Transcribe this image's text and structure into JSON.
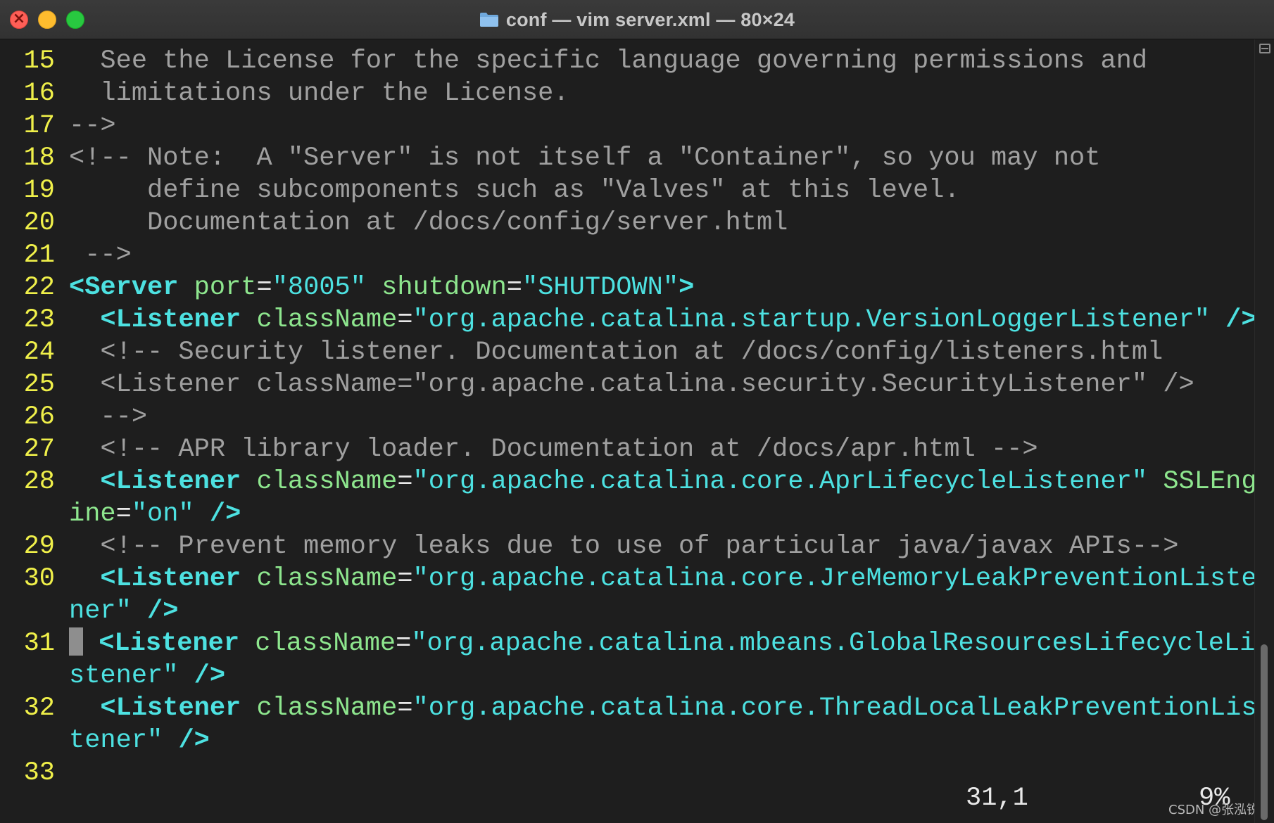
{
  "window": {
    "title": "conf — vim server.xml — 80×24",
    "folder_icon": "folder-icon"
  },
  "lines": [
    {
      "n": "15",
      "y": 0,
      "segs": [
        [
          "c",
          "  See the License for the specific language governing permissions and"
        ]
      ]
    },
    {
      "n": "16",
      "y": 1,
      "segs": [
        [
          "c",
          "  limitations under the License."
        ]
      ]
    },
    {
      "n": "17",
      "y": 2,
      "segs": [
        [
          "c",
          "-->"
        ]
      ]
    },
    {
      "n": "18",
      "y": 3,
      "segs": [
        [
          "c",
          "<!-- Note:  A \"Server\" is not itself a \"Container\", so you may not"
        ]
      ]
    },
    {
      "n": "19",
      "y": 4,
      "segs": [
        [
          "c",
          "     define subcomponents such as \"Valves\" at this level."
        ]
      ]
    },
    {
      "n": "20",
      "y": 5,
      "segs": [
        [
          "c",
          "     Documentation at /docs/config/server.html"
        ]
      ]
    },
    {
      "n": "21",
      "y": 6,
      "segs": [
        [
          "c",
          " -->"
        ]
      ]
    },
    {
      "n": "22",
      "y": 7,
      "segs": [
        [
          "tag",
          "<Server"
        ],
        [
          "plain",
          " "
        ],
        [
          "attr",
          "port"
        ],
        [
          "plain",
          "="
        ],
        [
          "val",
          "\"8005\""
        ],
        [
          "plain",
          " "
        ],
        [
          "attr",
          "shutdown"
        ],
        [
          "plain",
          "="
        ],
        [
          "val",
          "\"SHUTDOWN\""
        ],
        [
          "tag",
          ">"
        ]
      ]
    },
    {
      "n": "23",
      "y": 8,
      "segs": [
        [
          "plain",
          "  "
        ],
        [
          "tag",
          "<Listener"
        ],
        [
          "plain",
          " "
        ],
        [
          "attr",
          "className"
        ],
        [
          "plain",
          "="
        ],
        [
          "val",
          "\"org.apache.catalina.startup.VersionLoggerListener\""
        ],
        [
          "plain",
          " "
        ],
        [
          "tag",
          "/>"
        ]
      ]
    },
    {
      "n": "24",
      "y": 9,
      "segs": [
        [
          "c",
          "  <!-- Security listener. Documentation at /docs/config/listeners.html"
        ]
      ]
    },
    {
      "n": "25",
      "y": 10,
      "segs": [
        [
          "c",
          "  <Listener className=\"org.apache.catalina.security.SecurityListener\" />"
        ]
      ]
    },
    {
      "n": "26",
      "y": 11,
      "segs": [
        [
          "c",
          "  -->"
        ]
      ]
    },
    {
      "n": "27",
      "y": 12,
      "segs": [
        [
          "c",
          "  <!-- APR library loader. Documentation at /docs/apr.html -->"
        ]
      ]
    },
    {
      "n": "28",
      "y": 13,
      "segs": [
        [
          "plain",
          "  "
        ],
        [
          "tag",
          "<Listener"
        ],
        [
          "plain",
          " "
        ],
        [
          "attr",
          "className"
        ],
        [
          "plain",
          "="
        ],
        [
          "val",
          "\"org.apache.catalina.core.AprLifecycleListener\""
        ],
        [
          "plain",
          " "
        ],
        [
          "attr",
          "SSLEng"
        ]
      ]
    },
    {
      "n": "",
      "y": 14,
      "segs": [
        [
          "attr",
          "ine"
        ],
        [
          "plain",
          "="
        ],
        [
          "val",
          "\"on\""
        ],
        [
          "plain",
          " "
        ],
        [
          "tag",
          "/>"
        ]
      ]
    },
    {
      "n": "29",
      "y": 15,
      "segs": [
        [
          "c",
          "  <!-- Prevent memory leaks due to use of particular java/javax APIs-->"
        ]
      ]
    },
    {
      "n": "30",
      "y": 16,
      "segs": [
        [
          "plain",
          "  "
        ],
        [
          "tag",
          "<Listener"
        ],
        [
          "plain",
          " "
        ],
        [
          "attr",
          "className"
        ],
        [
          "plain",
          "="
        ],
        [
          "val",
          "\"org.apache.catalina.core.JreMemoryLeakPreventionListe"
        ]
      ]
    },
    {
      "n": "",
      "y": 17,
      "segs": [
        [
          "val",
          "ner\""
        ],
        [
          "plain",
          " "
        ],
        [
          "tag",
          "/>"
        ]
      ]
    },
    {
      "n": "31",
      "y": 18,
      "segs": [
        [
          "cursor",
          ""
        ],
        [
          "plain",
          " "
        ],
        [
          "tag",
          "<Listener"
        ],
        [
          "plain",
          " "
        ],
        [
          "attr",
          "className"
        ],
        [
          "plain",
          "="
        ],
        [
          "val",
          "\"org.apache.catalina.mbeans.GlobalResourcesLifecycleLi"
        ]
      ]
    },
    {
      "n": "",
      "y": 19,
      "segs": [
        [
          "val",
          "stener\""
        ],
        [
          "plain",
          " "
        ],
        [
          "tag",
          "/>"
        ]
      ]
    },
    {
      "n": "32",
      "y": 20,
      "segs": [
        [
          "plain",
          "  "
        ],
        [
          "tag",
          "<Listener"
        ],
        [
          "plain",
          " "
        ],
        [
          "attr",
          "className"
        ],
        [
          "plain",
          "="
        ],
        [
          "val",
          "\"org.apache.catalina.core.ThreadLocalLeakPreventionLis"
        ]
      ]
    },
    {
      "n": "",
      "y": 21,
      "segs": [
        [
          "val",
          "tener\""
        ],
        [
          "plain",
          " "
        ],
        [
          "tag",
          "/>"
        ]
      ]
    },
    {
      "n": "33",
      "y": 22,
      "segs": []
    }
  ],
  "status": {
    "position": "31,1",
    "percent": "9%"
  },
  "watermark": "CSDN @张泓锐",
  "colors": {
    "line_number": "#f0f04a",
    "comment": "#a0a0a0",
    "tag": "#4de1e1",
    "attribute": "#8ee68e",
    "value": "#4de1e1",
    "background": "#1e1e1e"
  }
}
